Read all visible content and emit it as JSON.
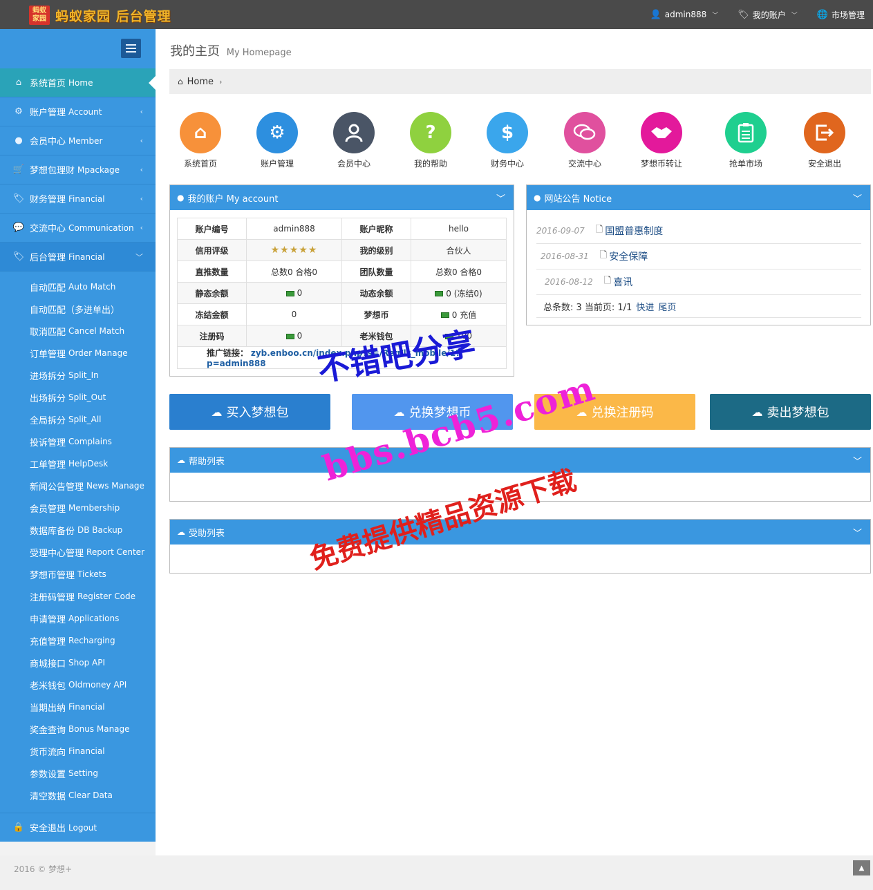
{
  "header": {
    "logo_badge": "蚂蚁\n家园",
    "logo_text": "蚂蚁家园 后台管理",
    "nav": [
      {
        "label": "admin888",
        "icon": "user-icon"
      },
      {
        "label": "我的账户",
        "icon": "tags-icon"
      },
      {
        "label": "市场管理",
        "icon": "globe-icon"
      }
    ]
  },
  "sidebar": {
    "items": [
      {
        "cn": "系统首页",
        "en": "Home",
        "icon": "home-icon"
      },
      {
        "cn": "账户管理",
        "en": "Account",
        "icon": "gear-icon"
      },
      {
        "cn": "会员中心",
        "en": "Member",
        "icon": "user-icon"
      },
      {
        "cn": "梦想包理财",
        "en": "Mpackage",
        "icon": "cart-icon"
      },
      {
        "cn": "财务管理",
        "en": "Financial",
        "icon": "tags-icon"
      },
      {
        "cn": "交流中心",
        "en": "Communication",
        "icon": "comments-icon"
      },
      {
        "cn": "后台管理",
        "en": "Financial",
        "icon": "tags-icon"
      }
    ],
    "submenu": [
      {
        "cn": "自动匹配",
        "en": "Auto Match"
      },
      {
        "cn": "自动匹配（多进单出）",
        "en": ""
      },
      {
        "cn": "取消匹配",
        "en": "Cancel Match"
      },
      {
        "cn": "订单管理",
        "en": "Order Manage"
      },
      {
        "cn": "进场拆分",
        "en": "Split_In"
      },
      {
        "cn": "出场拆分",
        "en": "Split_Out"
      },
      {
        "cn": "全局拆分",
        "en": "Split_All"
      },
      {
        "cn": "投诉管理",
        "en": "Complains"
      },
      {
        "cn": "工单管理",
        "en": "HelpDesk"
      },
      {
        "cn": "新闻公告管理",
        "en": "News Manage"
      },
      {
        "cn": "会员管理",
        "en": "Membership"
      },
      {
        "cn": "数据库备份",
        "en": "DB Backup"
      },
      {
        "cn": "受理中心管理",
        "en": "Report Center"
      },
      {
        "cn": "梦想币管理",
        "en": "Tickets"
      },
      {
        "cn": "注册码管理",
        "en": "Register Code"
      },
      {
        "cn": "申请管理",
        "en": "Applications"
      },
      {
        "cn": "充值管理",
        "en": "Recharging"
      },
      {
        "cn": "商城接口",
        "en": "Shop API"
      },
      {
        "cn": "老米钱包",
        "en": "Oldmoney API"
      },
      {
        "cn": "当期出纳",
        "en": "Financial"
      },
      {
        "cn": "奖金查询",
        "en": "Bonus Manage"
      },
      {
        "cn": "货币流向",
        "en": "Financial"
      },
      {
        "cn": "参数设置",
        "en": "Setting"
      },
      {
        "cn": "清空数据",
        "en": "Clear Data"
      }
    ],
    "logout": {
      "cn": "安全退出",
      "en": "Logout"
    }
  },
  "main": {
    "title": "我的主页",
    "title_en": "My Homepage",
    "breadcrumb": "Home",
    "quick_links": [
      {
        "label": "系统首页",
        "color": "#f7913a",
        "icon": "home-icon",
        "glyph": "⌂"
      },
      {
        "label": "账户管理",
        "color": "#2d8fdf",
        "icon": "gear-icon",
        "glyph": "⚙"
      },
      {
        "label": "会员中心",
        "color": "#4a5566",
        "icon": "user-icon",
        "glyph": "👤"
      },
      {
        "label": "我的帮助",
        "color": "#8fd13f",
        "icon": "question-icon",
        "glyph": "?"
      },
      {
        "label": "财务中心",
        "color": "#3aa6ec",
        "icon": "dollar-icon",
        "glyph": "$"
      },
      {
        "label": "交流中心",
        "color": "#e0509e",
        "icon": "comments-icon",
        "glyph": "💬"
      },
      {
        "label": "梦想币转让",
        "color": "#e3199b",
        "icon": "handshake-icon",
        "glyph": "🤝"
      },
      {
        "label": "抢单市场",
        "color": "#1fcf8f",
        "icon": "clipboard-icon",
        "glyph": "📋"
      },
      {
        "label": "安全退出",
        "color": "#e0661e",
        "icon": "exit-icon",
        "glyph": "⇥"
      }
    ],
    "account": {
      "title": "我的账户 My account",
      "rows": [
        {
          "l1": "账户编号",
          "v1": "admin888",
          "l2": "账户昵称",
          "v2": "hello"
        },
        {
          "l1": "信用评级",
          "v1": "★★★★★",
          "l2": "我的级别",
          "v2": "合伙人"
        },
        {
          "l1": "直推数量",
          "v1": "总数0 合格0",
          "l2": "团队数量",
          "v2": "总数0 合格0"
        },
        {
          "l1": "静态余额",
          "v1": "0",
          "l2": "动态余额",
          "v2": "0 (冻结0)"
        },
        {
          "l1": "冻结金额",
          "v1": "0",
          "l2": "梦想币",
          "v2": "0 充值"
        },
        {
          "l1": "注册码",
          "v1": "0",
          "l2": "老米钱包",
          "v2": "100"
        }
      ],
      "promo_label": "推广链接：",
      "promo_url": "zyb.enboo.cn/index.php?s=/Reg/ls_mobile/1?p=admin888"
    },
    "notice": {
      "title": "网站公告 Notice",
      "items": [
        {
          "date": "2016-09-07",
          "title": "国盟普惠制度"
        },
        {
          "date": "2016-08-31",
          "title": "安全保障"
        },
        {
          "date": "2016-08-12",
          "title": "喜讯"
        }
      ],
      "footer": "总条数: 3 当前页: 1/1",
      "footer_link1": "快进",
      "footer_link2": "尾页"
    },
    "actions": [
      {
        "label": "买入梦想包",
        "color": "#2a7fcf"
      },
      {
        "label": "兑换梦想币",
        "color": "#5196ee"
      },
      {
        "label": "兑换注册码",
        "color": "#fbb848"
      },
      {
        "label": "卖出梦想包",
        "color": "#1c6a85"
      }
    ],
    "help_list": "帮助列表",
    "receive_list": "受助列表"
  },
  "footer": {
    "text": "2016 © 梦想+"
  },
  "watermark": {
    "line1": "不错吧分享",
    "line2": "bbs.bcb5.com",
    "line3": "免费提供精品资源下载"
  }
}
